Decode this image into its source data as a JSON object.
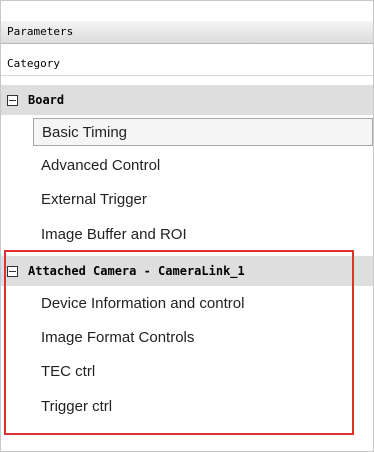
{
  "header": {
    "title": "Parameters",
    "category_label": "Category"
  },
  "groups": [
    {
      "label": "Board",
      "items": [
        "Basic Timing",
        "Advanced Control",
        "External Trigger",
        "Image Buffer and ROI"
      ]
    },
    {
      "label": "Attached Camera - CameraLink_1",
      "items": [
        "Device Information and control",
        "Image Format Controls",
        "TEC ctrl",
        "Trigger ctrl"
      ]
    }
  ],
  "selected_item": "Basic Timing",
  "colors": {
    "group_bg": "#dedede",
    "highlight_border": "#e03030",
    "selected_bg": "#f5f5f5"
  }
}
